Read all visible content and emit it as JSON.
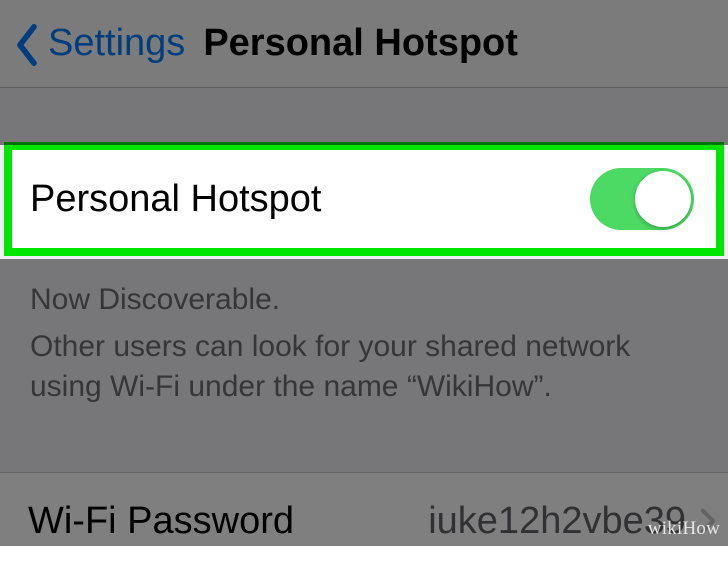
{
  "nav": {
    "back_label": "Settings",
    "title": "Personal Hotspot"
  },
  "hotspot_row": {
    "label": "Personal Hotspot",
    "enabled": true
  },
  "footer": {
    "line1": "Now Discoverable.",
    "line2": "Other users can look for your shared network using Wi-Fi under the name “WikiHow”."
  },
  "password_row": {
    "label": "Wi-Fi Password",
    "value": "iuke12h2vbe39"
  },
  "watermark": "wikiHow"
}
